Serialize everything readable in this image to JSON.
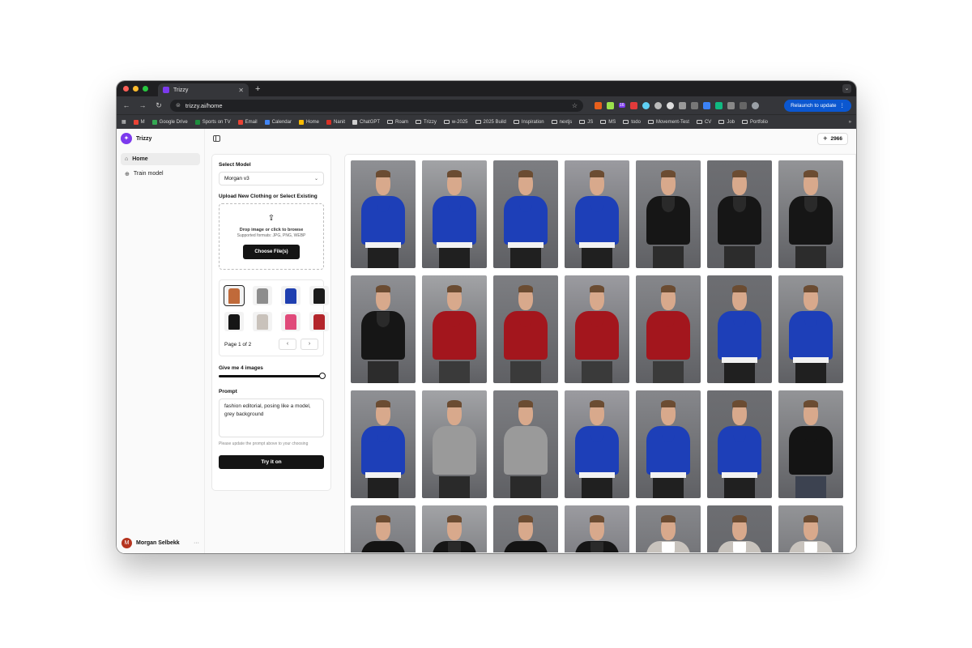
{
  "browser": {
    "tab_title": "Trizzy",
    "url": "trizzy.ai/home",
    "relaunch_label": "Relaunch to update",
    "extension_badge": "16",
    "bookmarks": [
      {
        "label": "M",
        "color": "#ea4335"
      },
      {
        "label": "Google Drive",
        "color": "#34a853"
      },
      {
        "label": "Sports on TV",
        "color": "#1e8e3e"
      },
      {
        "label": "Email",
        "color": "#ea4335"
      },
      {
        "label": "Calendar",
        "color": "#4285f4"
      },
      {
        "label": "Home",
        "color": "#fbbc04"
      },
      {
        "label": "Nanit",
        "color": "#d93025"
      },
      {
        "label": "ChatGPT",
        "color": "#cfcfcf"
      },
      {
        "label": "Roam",
        "folder": true
      },
      {
        "label": "Trizzy",
        "folder": true
      },
      {
        "label": "w-2025",
        "folder": true
      },
      {
        "label": "2025 Build",
        "folder": true
      },
      {
        "label": "Inspiration",
        "folder": true
      },
      {
        "label": "nextjs",
        "folder": true
      },
      {
        "label": "JS",
        "folder": true
      },
      {
        "label": "MS",
        "folder": true
      },
      {
        "label": "todo",
        "folder": true
      },
      {
        "label": "Movement-Test",
        "folder": true
      },
      {
        "label": "CV",
        "folder": true
      },
      {
        "label": "Job",
        "folder": true
      },
      {
        "label": "Portfolio",
        "folder": true
      }
    ]
  },
  "sidebar": {
    "brand": "Trizzy",
    "items": [
      {
        "label": "Home",
        "icon": "home-icon"
      },
      {
        "label": "Train model",
        "icon": "sparkle-icon"
      }
    ],
    "user": {
      "name": "Morgan Selbekk",
      "initial": "M"
    }
  },
  "header": {
    "credits": "2966"
  },
  "form": {
    "model_label": "Select Model",
    "model_value": "Morgan v3",
    "upload_label": "Upload New Clothing or Select Existing",
    "drop_title": "Drop image or click to browse",
    "drop_formats": "Supported formats: JPG, PNG, WEBP",
    "choose_button": "Choose File(s)",
    "page_text": "Page 1 of 2",
    "count_label": "Give me 4 images",
    "image_count": 4,
    "prompt_label": "Prompt",
    "prompt_value": "fashion editorial, posing like a model, grey background",
    "prompt_hint": "Please update the prompt above to your choosing",
    "submit_button": "Try it on",
    "clothing_items": [
      {
        "name": "orange-outfit",
        "color": "#c06a3a",
        "selected": true
      },
      {
        "name": "grey-tshirt",
        "color": "#8d8d8d"
      },
      {
        "name": "blue-hoodie",
        "color": "#1f3fb0"
      },
      {
        "name": "black-sweater",
        "color": "#1b1b1b"
      },
      {
        "name": "black-blazer",
        "color": "#161616"
      },
      {
        "name": "patterned-blazer",
        "color": "#c9c2bb"
      },
      {
        "name": "graphic-tee",
        "color": "#e04a7a"
      },
      {
        "name": "red-shirt",
        "color": "#b3252b"
      }
    ]
  },
  "results": {
    "outfits": [
      "hoodie",
      "hoodie",
      "hoodie",
      "hoodie",
      "blazer",
      "blazer",
      "blazer",
      "blazer",
      "polo",
      "polo",
      "polo",
      "polo",
      "hoodie",
      "hoodie",
      "hoodie",
      "tee",
      "tee",
      "hoodie",
      "hoodie",
      "hoodie",
      "sweater",
      "sweater",
      "blazer",
      "sweater",
      "blazer",
      "suit",
      "suit",
      "suit"
    ]
  }
}
